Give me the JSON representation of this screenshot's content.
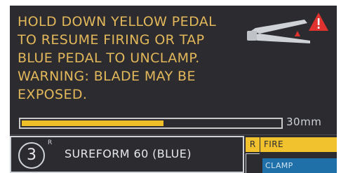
{
  "message": {
    "lines": [
      "HOLD DOWN YELLOW PEDAL",
      "TO RESUME FIRING OR TAP",
      "BLUE PEDAL TO UNCLAMP.",
      "WARNING: BLADE MAY BE",
      "EXPOSED."
    ]
  },
  "icons": {
    "stapler": "stapler-icon",
    "warning": "warning-triangle-icon"
  },
  "progress": {
    "fraction": 0.55,
    "label": "30mm"
  },
  "cartridge": {
    "arm_number": "3",
    "arm_superscript": "R",
    "reload_name": "SUREFORM 60 (BLUE)"
  },
  "pedals": {
    "fire_side": "R",
    "fire_label": "FIRE",
    "clamp_label": "CLAMP"
  },
  "colors": {
    "background": "#2c2b30",
    "message": "#e3b85a",
    "fire_pedal": "#f2c22e",
    "clamp_pedal": "#1f6fa8",
    "warning": "#e0322e"
  }
}
